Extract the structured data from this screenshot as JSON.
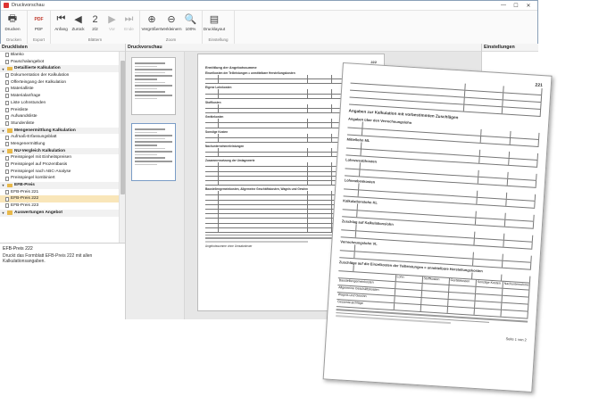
{
  "window": {
    "title": "Druckvorschau",
    "min": "—",
    "max": "☐",
    "close": "✕"
  },
  "ribbon": {
    "groups": [
      {
        "label": "Drucken",
        "buttons": [
          {
            "label": "Drucken",
            "icon": "printer-icon",
            "glyph": "🖶",
            "disabled": false
          }
        ]
      },
      {
        "label": "Export",
        "buttons": [
          {
            "label": "PDF",
            "icon": "pdf-icon",
            "glyph": "PDF",
            "disabled": false
          }
        ]
      },
      {
        "label": "Blättern",
        "buttons": [
          {
            "label": "Anfang",
            "icon": "first-page-icon",
            "glyph": "⏮",
            "disabled": false
          },
          {
            "label": "Zurück",
            "icon": "previous-page-icon",
            "glyph": "◀",
            "disabled": false
          },
          {
            "label": "2/2",
            "icon": "page-counter-icon",
            "glyph": "2",
            "disabled": false
          },
          {
            "label": "Vor",
            "icon": "next-page-icon",
            "glyph": "▶",
            "disabled": true
          },
          {
            "label": "Ende",
            "icon": "last-page-icon",
            "glyph": "⏭",
            "disabled": true
          }
        ]
      },
      {
        "label": "Zoom",
        "buttons": [
          {
            "label": "Vergrößern",
            "icon": "zoom-in-icon",
            "glyph": "⊕",
            "disabled": false
          },
          {
            "label": "Verkleinern",
            "icon": "zoom-out-icon",
            "glyph": "⊖",
            "disabled": false
          },
          {
            "label": "100%",
            "icon": "zoom-level-icon",
            "glyph": "🔍",
            "disabled": false
          }
        ]
      },
      {
        "label": "Einstellung",
        "buttons": [
          {
            "label": "Drucklayout",
            "icon": "print-layout-icon",
            "glyph": "▤",
            "disabled": false
          }
        ]
      }
    ]
  },
  "left_pane": {
    "title": "Drucklisten",
    "tree": [
      {
        "label": "Blanko",
        "kind": "doc"
      },
      {
        "label": "Pauschalangebot",
        "kind": "doc"
      },
      {
        "label": "Detaillierte Kalkulation",
        "kind": "cat"
      },
      {
        "label": "Dokumentation der Kalkulation",
        "kind": "doc"
      },
      {
        "label": "Offerteingang der Kalkulation",
        "kind": "doc"
      },
      {
        "label": "Materialliste",
        "kind": "doc"
      },
      {
        "label": "Materialanfrage",
        "kind": "doc"
      },
      {
        "label": "Liste Lohnstunden",
        "kind": "doc"
      },
      {
        "label": "Preisliste",
        "kind": "doc"
      },
      {
        "label": "Aufwandsliste",
        "kind": "doc"
      },
      {
        "label": "Stundenliste",
        "kind": "doc"
      },
      {
        "label": "Mengenermittlung Kalkulation",
        "kind": "cat"
      },
      {
        "label": "Aufmaß-Erfassungsblatt",
        "kind": "doc"
      },
      {
        "label": "Mengenermittlung",
        "kind": "doc"
      },
      {
        "label": "NU-Vergleich Kalkulation",
        "kind": "cat"
      },
      {
        "label": "Preisspiegel mit Einheitspreisen",
        "kind": "doc"
      },
      {
        "label": "Preisspiegel auf Prozentbasis",
        "kind": "doc"
      },
      {
        "label": "Preisspiegel nach ABC-Analyse",
        "kind": "doc"
      },
      {
        "label": "Preisspiegel kombiniert",
        "kind": "doc"
      },
      {
        "label": "EFB-Preis",
        "kind": "cat"
      },
      {
        "label": "EFB-Preis 221",
        "kind": "doc"
      },
      {
        "label": "EFB-Preis 222",
        "kind": "doc",
        "selected": true
      },
      {
        "label": "EFB-Preis 223",
        "kind": "doc"
      },
      {
        "label": "Auswertungen Angebot",
        "kind": "cat"
      }
    ],
    "description": {
      "title": "EFB-Preis 222",
      "text": "Druckt das Formblatt EFB-Preis 222 mit allen Kalkulationsangaben."
    }
  },
  "preview_pane": {
    "title": "Druckvorschau",
    "page1": {
      "form_no": "222",
      "heading": "Ermittlung der Angebotssumme",
      "sections": [
        "Einzelkosten der Teilleistungen = unmittelbare Herstellungskosten",
        "Eigene Lohnkosten",
        "Stoffkosten",
        "Gerätekosten",
        "Sonstige Kosten",
        "Nachunternehmerleistungen",
        "Zusammensetzung der Umlagewerte",
        "Baustellengemeinkosten, Allgemeine Geschäftskosten, Wagnis und Gewinn"
      ],
      "footer": "Angebotssumme ohne Umsatzsteuer"
    },
    "page2": {
      "form_no": "221",
      "heading": "Angaben zur Kalkulation mit vorbestimmten Zuschlägen",
      "sections": [
        "Angaben über den Verrechnungslohn",
        "Mittellohn ML",
        "Lohnzusatzkosten",
        "Lohnnebenkosten",
        "Kalkulationslohn KL",
        "Zuschlag auf Kalkulationslohn",
        "Verrechnungslohn VL",
        "Zuschläge auf die Einzelkosten der Teilleistungen = unmittelbare Herstellungskosten"
      ],
      "table_headers": [
        "Lohn",
        "Stoffkosten",
        "Gerätekosten",
        "Sonstige Kosten",
        "Nachunternehmerleistungen"
      ],
      "table_rows": [
        "Baustellengemeinkosten",
        "Allgemeine Geschäftskosten",
        "Wagnis und Gewinn",
        "Gesamtzuschläge"
      ],
      "page_label": "Seite 1 von 2"
    }
  },
  "right_pane": {
    "title": "Einstellungen"
  }
}
